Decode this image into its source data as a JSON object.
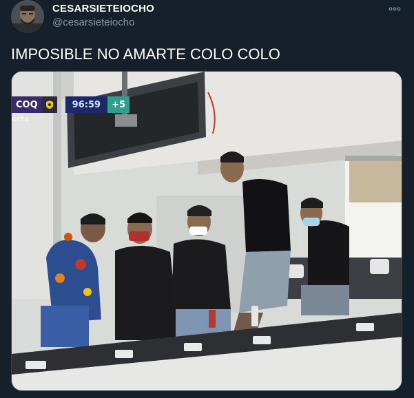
{
  "tweet": {
    "display_name": "CESARSIETEIOCHO",
    "handle": "@cesarsieteiocho",
    "text": "IMPOSIBLE NO AMARTE COLO COLO",
    "more_icon": "more-horizontal-icon"
  },
  "media": {
    "scorebug": {
      "team": "COQ",
      "clock": "96:59",
      "added_time": "+5",
      "sub_label": "orts"
    }
  },
  "colors": {
    "background": "#15202b",
    "text_primary": "#ffffff",
    "text_secondary": "#8899a6",
    "border": "#38444d"
  }
}
